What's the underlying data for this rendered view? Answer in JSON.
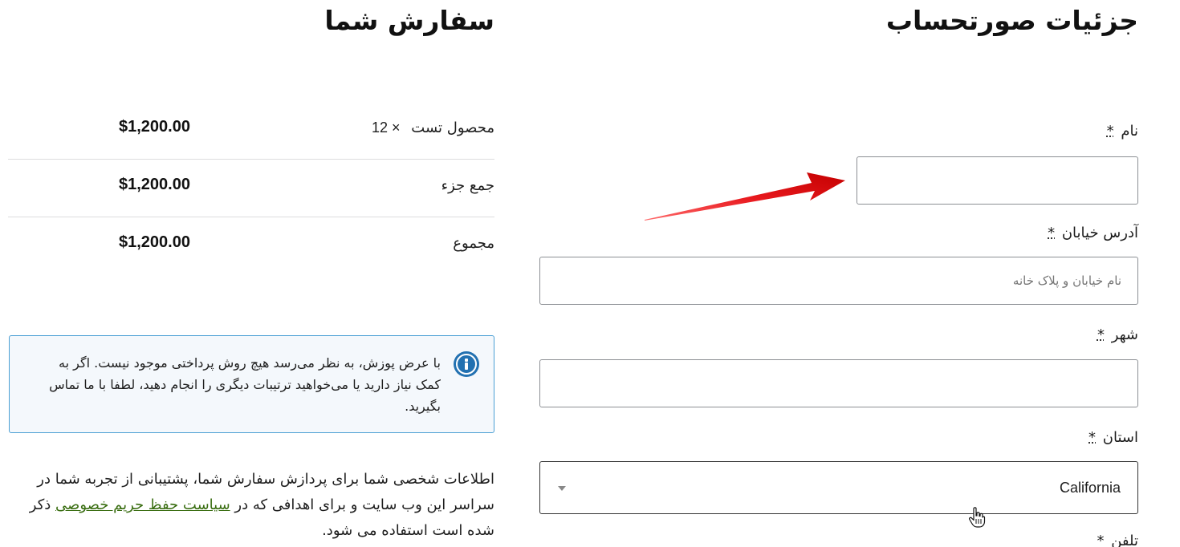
{
  "billing": {
    "title": "جزئیات صورتحساب",
    "required_mark": "*",
    "fields": {
      "first_name": {
        "label": "نام",
        "value": "",
        "placeholder": ""
      },
      "street": {
        "label": "آدرس خیابان",
        "value": "",
        "placeholder": "نام خیابان و پلاک خانه"
      },
      "city": {
        "label": "شهر",
        "value": "",
        "placeholder": ""
      },
      "state": {
        "label": "استان",
        "value": "California"
      },
      "phone": {
        "label": "تلفن"
      }
    }
  },
  "order": {
    "title": "سفارش شما",
    "rows": [
      {
        "name": "محصول تست",
        "qty": "× 12",
        "price": "$1,200.00"
      },
      {
        "name": "جمع جزء",
        "price": "$1,200.00"
      },
      {
        "name": "مجموع",
        "price": "$1,200.00"
      }
    ]
  },
  "notice": {
    "text": "با عرض پوزش، به نظر می‌رسد هیچ روش پرداختی موجود نیست. اگر به کمک نیاز دارید یا می‌خواهید ترتیبات دیگری را انجام دهید، لطفا با ما تماس بگیرید."
  },
  "privacy": {
    "text_before": "اطلاعات شخصی شما برای پردازش سفارش شما، پشتیبانی از تجربه شما در سراسر این وب سایت و برای اهدافی که در",
    "link_text": "سیاست حفظ حریم خصوصی",
    "text_after": "ذکر شده است استفاده می شود."
  },
  "colors": {
    "annotation_arrow": "#e8191e",
    "notice_border": "#4a9fd4",
    "notice_icon": "#2271b1",
    "link": "#3a6e12"
  },
  "icons": {
    "notice": "info-icon",
    "state_select": "chevron-down-icon",
    "cursor": "hand-pointer-icon",
    "annotation": "red-arrow-annotation"
  }
}
